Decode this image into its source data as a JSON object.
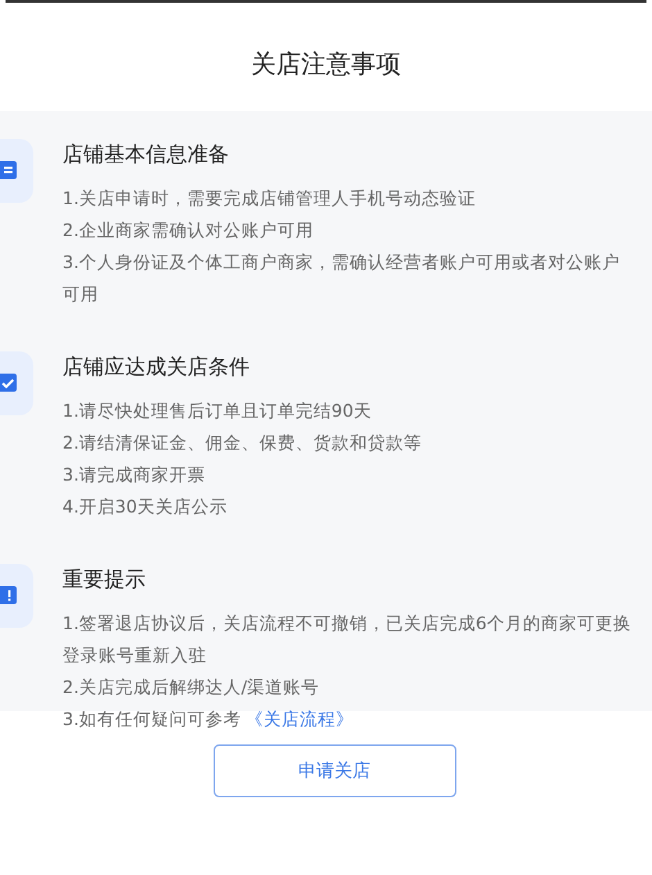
{
  "title": "关店注意事项",
  "sections": [
    {
      "kind": "id",
      "heading": "店铺基本信息准备",
      "items": [
        {
          "text": "1.关店申请时，需要完成店铺管理人手机号动态验证"
        },
        {
          "text": "2.企业商家需确认对公账户可用"
        },
        {
          "text": "3.个人身份证及个体工商户商家，需确认经营者账户可用或者对公账户可用"
        }
      ]
    },
    {
      "kind": "check",
      "heading": "店铺应达成关店条件",
      "items": [
        {
          "text": "1.请尽快处理售后订单且订单完结90天"
        },
        {
          "text": "2.请结清保证金、佣金、保费、货款和贷款等"
        },
        {
          "text": "3.请完成商家开票"
        },
        {
          "text": "4.开启30天关店公示"
        }
      ]
    },
    {
      "kind": "alert",
      "heading": "重要提示",
      "items": [
        {
          "text": "1.签署退店协议后，关店流程不可撤销，已关店完成6个月的商家可更换登录账号重新入驻"
        },
        {
          "text": "2.关店完成后解绑达人/渠道账号"
        },
        {
          "text": "3.如有任何疑问可参考",
          "link": "《关店流程》"
        }
      ]
    }
  ],
  "button": "申请关店"
}
